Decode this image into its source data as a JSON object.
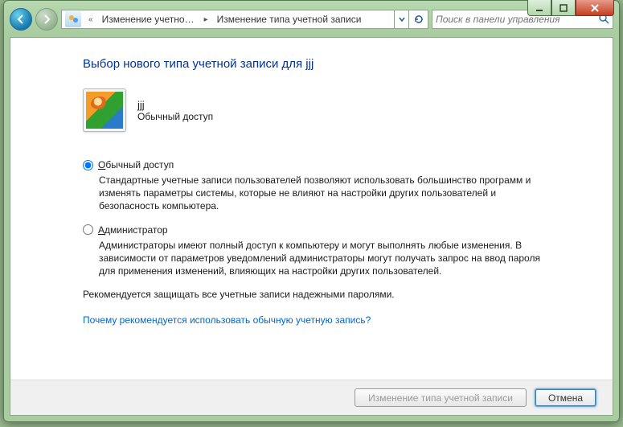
{
  "breadcrumb": {
    "icon": "user-accounts-icon",
    "item1": "Изменение учетно",
    "item2": "Изменение типа учетной записи"
  },
  "search": {
    "placeholder": "Поиск в панели управления"
  },
  "heading": "Выбор нового типа учетной записи для jjj",
  "user": {
    "name": "jjj",
    "type": "Обычный доступ"
  },
  "options": {
    "standard": {
      "label_hotkey": "О",
      "label_rest": "бычный доступ",
      "desc": "Стандартные учетные записи пользователей позволяют использовать большинство программ и изменять параметры системы, которые не влияют на настройки других пользователей и безопасность компьютера.",
      "checked": true
    },
    "admin": {
      "label_hotkey": "А",
      "label_rest": "дминистратор",
      "desc": "Администраторы имеют полный доступ к компьютеру и могут выполнять любые изменения. В зависимости от параметров уведомлений администраторы могут получать запрос на ввод пароля для применения изменений, влияющих на настройки других пользователей.",
      "checked": false
    }
  },
  "tip": "Рекомендуется защищать все учетные записи надежными паролями.",
  "help_link": "Почему рекомендуется использовать обычную учетную запись?",
  "buttons": {
    "apply": "Изменение типа учетной записи",
    "cancel": "Отмена"
  }
}
